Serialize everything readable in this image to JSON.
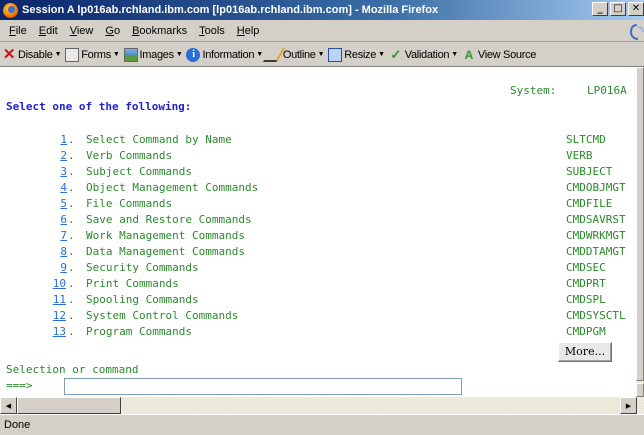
{
  "window": {
    "title": "Session A lp016ab.rchland.ibm.com [lp016ab.rchland.ibm.com] - Mozilla Firefox",
    "minimize": "_",
    "maximize": "□",
    "close": "✕"
  },
  "menubar": {
    "items": [
      {
        "label": "File",
        "key": "F",
        "rest": "ile"
      },
      {
        "label": "Edit",
        "key": "E",
        "rest": "dit"
      },
      {
        "label": "View",
        "key": "V",
        "rest": "iew"
      },
      {
        "label": "Go",
        "key": "G",
        "rest": "o"
      },
      {
        "label": "Bookmarks",
        "key": "B",
        "rest": "ookmarks"
      },
      {
        "label": "Tools",
        "key": "T",
        "rest": "ools"
      },
      {
        "label": "Help",
        "key": "H",
        "rest": "elp"
      }
    ]
  },
  "devbar": {
    "items": [
      {
        "label": "Disable",
        "icon": "disable-icon"
      },
      {
        "label": "Forms",
        "icon": "forms-icon"
      },
      {
        "label": "Images",
        "icon": "images-icon"
      },
      {
        "label": "Information",
        "icon": "information-icon"
      },
      {
        "label": "Outline",
        "icon": "outline-icon"
      },
      {
        "label": "Resize",
        "icon": "resize-icon"
      },
      {
        "label": "Validation",
        "icon": "validation-icon"
      },
      {
        "label": "View Source",
        "icon": "view-source-icon"
      }
    ]
  },
  "screen": {
    "system_label": "System:",
    "system_value": "LP016A",
    "prompt": "Select one of the following:",
    "options": [
      {
        "num": "1",
        "desc": "Select Command by Name",
        "cmd": "SLTCMD"
      },
      {
        "num": "2",
        "desc": "Verb Commands",
        "cmd": "VERB"
      },
      {
        "num": "3",
        "desc": "Subject Commands",
        "cmd": "SUBJECT"
      },
      {
        "num": "4",
        "desc": "Object Management Commands",
        "cmd": "CMDOBJMGT"
      },
      {
        "num": "5",
        "desc": "File Commands",
        "cmd": "CMDFILE"
      },
      {
        "num": "6",
        "desc": "Save and Restore Commands",
        "cmd": "CMDSAVRST"
      },
      {
        "num": "7",
        "desc": "Work Management Commands",
        "cmd": "CMDWRKMGT"
      },
      {
        "num": "8",
        "desc": "Data Management Commands",
        "cmd": "CMDDTAMGT"
      },
      {
        "num": "9",
        "desc": "Security Commands",
        "cmd": "CMDSEC"
      },
      {
        "num": "10",
        "desc": "Print Commands",
        "cmd": "CMDPRT"
      },
      {
        "num": "11",
        "desc": "Spooling Commands",
        "cmd": "CMDSPL"
      },
      {
        "num": "12",
        "desc": "System Control Commands",
        "cmd": "CMDSYSCTL"
      },
      {
        "num": "13",
        "desc": "Program Commands",
        "cmd": "CMDPGM"
      }
    ],
    "more_label": "More...",
    "selection_label": "Selection or command",
    "arrow_prompt": "===>",
    "command_value": ""
  },
  "status": {
    "text": "Done"
  }
}
